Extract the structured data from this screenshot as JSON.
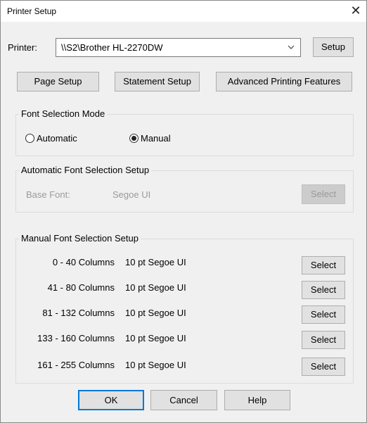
{
  "window": {
    "title": "Printer Setup",
    "close_glyph": "✕"
  },
  "printer": {
    "label": "Printer:",
    "value": "\\\\S2\\Brother HL-2270DW",
    "setup_button": "Setup"
  },
  "top_buttons": {
    "page_setup": "Page Setup",
    "statement_setup": "Statement Setup",
    "advanced": "Advanced Printing Features"
  },
  "font_mode": {
    "title": "Font Selection Mode",
    "automatic": "Automatic",
    "manual": "Manual",
    "selected": "Manual"
  },
  "auto_setup": {
    "title": "Automatic Font Selection Setup",
    "base_font_label": "Base Font:",
    "base_font_value": "Segoe UI",
    "select_button": "Select"
  },
  "manual_setup": {
    "title": "Manual Font Selection Setup",
    "rows": [
      {
        "columns": "0 - 40 Columns",
        "font": "10 pt Segoe UI",
        "button": "Select"
      },
      {
        "columns": "41 - 80 Columns",
        "font": "10 pt Segoe UI",
        "button": "Select"
      },
      {
        "columns": "81 - 132 Columns",
        "font": "10 pt Segoe UI",
        "button": "Select"
      },
      {
        "columns": "133 - 160 Columns",
        "font": "10 pt Segoe UI",
        "button": "Select"
      },
      {
        "columns": "161 - 255 Columns",
        "font": "10 pt Segoe UI",
        "button": "Select"
      }
    ]
  },
  "footer": {
    "ok": "OK",
    "cancel": "Cancel",
    "help": "Help"
  },
  "icons": {
    "close": "close-icon",
    "dropdown": "chevron-down-icon"
  }
}
